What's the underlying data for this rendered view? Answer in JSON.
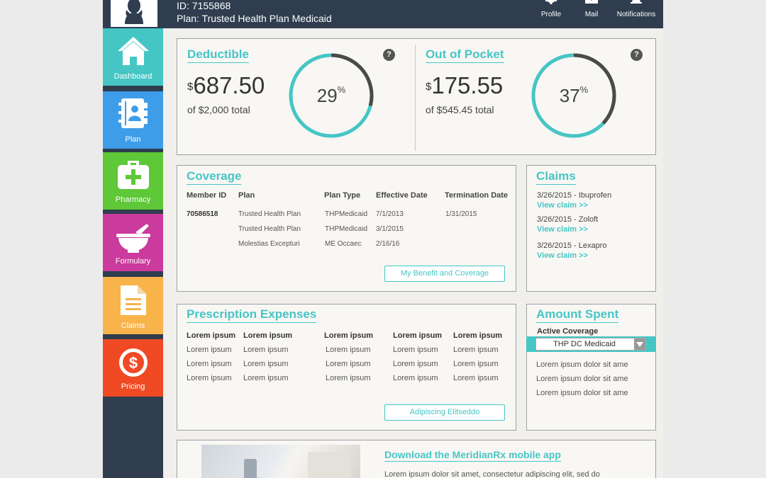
{
  "colors": {
    "accent": "#45c6c5",
    "header": "#2f3d4f",
    "dashboard": "#45c6c5",
    "plan": "#3e9de8",
    "pharmacy": "#5ec838",
    "formulary": "#cb3a9d",
    "claims": "#f8b34a",
    "pricing": "#ef4a24"
  },
  "header": {
    "id_text": "ID: 7155868",
    "plan_text": "Plan: Trusted Health Plan Medicaid",
    "buttons": [
      {
        "label": "Profile",
        "icon": "gear-icon"
      },
      {
        "label": "Mail",
        "icon": "mail-icon"
      },
      {
        "label": "Notifications",
        "icon": "bell-icon"
      }
    ]
  },
  "sidebar": {
    "items": [
      {
        "label": "Dashboard",
        "icon": "home-icon",
        "active": true
      },
      {
        "label": "Plan",
        "icon": "address-book-icon"
      },
      {
        "label": "Pharmacy",
        "icon": "first-aid-kit-icon"
      },
      {
        "label": "Formulary",
        "icon": "mortar-pestle-icon"
      },
      {
        "label": "Claims",
        "icon": "document-icon"
      },
      {
        "label": "Pricing",
        "icon": "dollar-icon"
      }
    ]
  },
  "deductible": {
    "title": "Deductible",
    "currency": "$",
    "amount": "687.50",
    "total_text": "of $2,000 total",
    "percent": 29,
    "percent_number": "29",
    "percent_sign": "%"
  },
  "out_of_pocket": {
    "title": "Out of Pocket",
    "currency": "$",
    "amount": "175.55",
    "total_text": "of $545.45 total",
    "percent": 37,
    "percent_number": "37",
    "percent_sign": "%"
  },
  "help_glyph": "?",
  "coverage": {
    "title": "Coverage",
    "headers": [
      "Member ID",
      "Plan",
      "Plan Type",
      "Effective Date",
      "Termination Date"
    ],
    "rows": [
      [
        "70586518",
        "Trusted Health Plan",
        "THPMedicaid",
        "7/1/2013",
        "1/31/2015"
      ],
      [
        "",
        "Trusted Health Plan",
        "THPMedicaid",
        "3/1/2015",
        ""
      ],
      [
        "",
        "Molestias Excepturi",
        "ME Occaec",
        "2/16/16",
        ""
      ]
    ],
    "button_label": "My Benefit and Coverage"
  },
  "claims": {
    "title": "Claims",
    "items": [
      {
        "text": "3/26/2015 - Ibuprofen",
        "link": "View claim >>"
      },
      {
        "text": "3/26/2015 - Zoloft",
        "link": "View claim >>"
      },
      {
        "text": "3/26/2015 - Lexapro",
        "link": "View claim >>"
      }
    ]
  },
  "prescription": {
    "title": "Prescription Expenses",
    "headers": [
      "Lorem ipsum",
      "Lorem ipsum",
      "Lorem ipsum",
      "Lorem ipsum",
      "Lorem ipsum"
    ],
    "rows": [
      [
        "Lorem ipsum",
        "Lorem ipsum",
        "Lorem ipsum",
        "Lorem ipsum",
        "Lorem ipsum"
      ],
      [
        "Lorem ipsum",
        "Lorem ipsum",
        "Lorem ipsum",
        "Lorem ipsum",
        "Lorem ipsum"
      ],
      [
        "Lorem ipsum",
        "Lorem ipsum",
        "Lorem ipsum",
        "Lorem ipsum",
        "Lorem ipsum"
      ]
    ],
    "button_label": "Adipiscing Elitseddo"
  },
  "amount_spent": {
    "title": "Amount Spent",
    "active_label": "Active Coverage",
    "selected": "THP DC Medicaid",
    "lines": [
      "Lorem ipsum dolor sit ame",
      "Lorem ipsum dolor sit ame",
      "Lorem ipsum dolor sit ame"
    ]
  },
  "mobile_app": {
    "title": "Download the MeridianRx mobile app",
    "text": "Lorem ipsum dolor sit amet, consectetur adipiscing elit, sed do"
  }
}
